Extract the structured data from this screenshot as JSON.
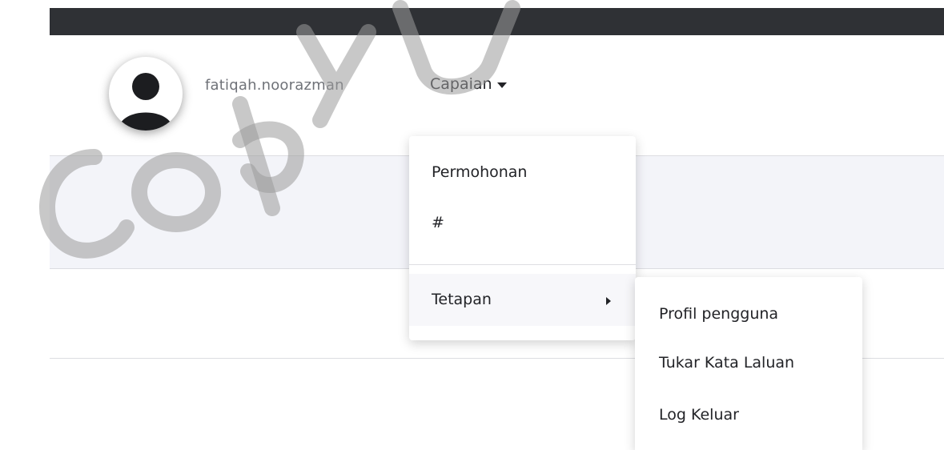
{
  "header": {
    "username": "fatiqah.noorazman",
    "nav_label": "Capaian",
    "avatar_icon": "user-silhouette-icon"
  },
  "menu": {
    "items": [
      {
        "label": "Permohonan"
      },
      {
        "label": "#"
      },
      {
        "label": "Tetapan",
        "has_submenu": true
      }
    ]
  },
  "submenu": {
    "items": [
      {
        "label": "Profil pengguna"
      },
      {
        "label": "Tukar Kata Laluan"
      },
      {
        "label": "Log Keluar"
      }
    ]
  },
  "watermark": {
    "text": "Copy UI",
    "color": "#9a9a9a"
  },
  "colors": {
    "topbar": "#2f3135",
    "band": "#f3f4f9",
    "text": "#222327",
    "muted_text": "#6f7278"
  }
}
